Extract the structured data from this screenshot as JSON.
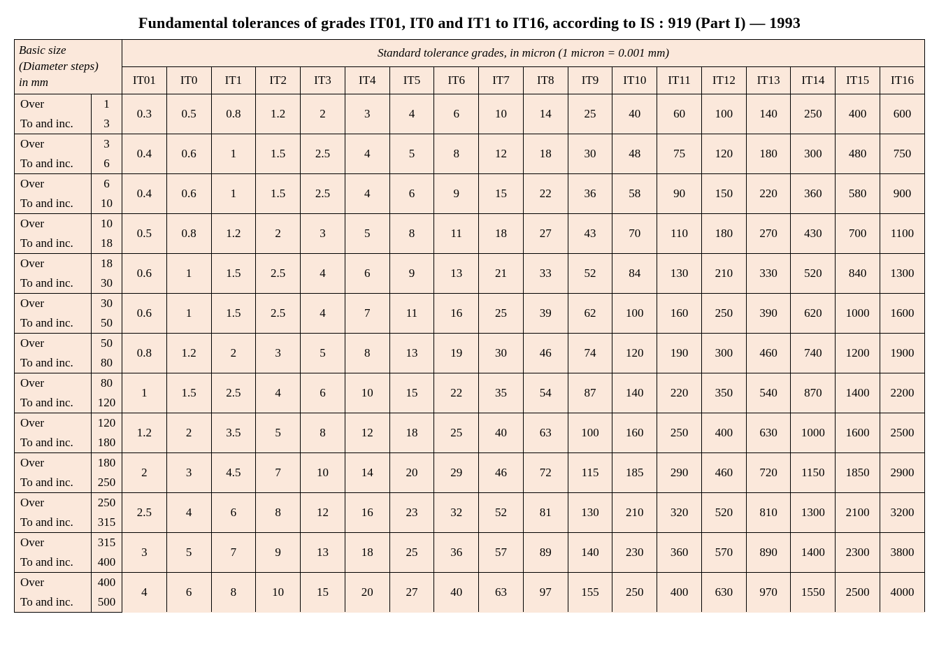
{
  "title": "Fundamental tolerances of grades IT01, IT0 and IT1 to IT16, according to IS : 919 (Part I) — 1993",
  "header": {
    "basic_size_line1": "Basic size",
    "basic_size_line2": "(Diameter steps)",
    "basic_size_line3": "in mm",
    "span_label": "Standard tolerance grades, in micron (1 micron = 0.001 mm)",
    "over_label": "Over",
    "to_inc_label": "To and inc."
  },
  "chart_data": {
    "type": "table",
    "grades": [
      "IT01",
      "IT0",
      "IT1",
      "IT2",
      "IT3",
      "IT4",
      "IT5",
      "IT6",
      "IT7",
      "IT8",
      "IT9",
      "IT10",
      "IT11",
      "IT12",
      "IT13",
      "IT14",
      "IT15",
      "IT16"
    ],
    "size_ranges": [
      {
        "over": "1",
        "to": "3"
      },
      {
        "over": "3",
        "to": "6"
      },
      {
        "over": "6",
        "to": "10"
      },
      {
        "over": "10",
        "to": "18"
      },
      {
        "over": "18",
        "to": "30"
      },
      {
        "over": "30",
        "to": "50"
      },
      {
        "over": "50",
        "to": "80"
      },
      {
        "over": "80",
        "to": "120"
      },
      {
        "over": "120",
        "to": "180"
      },
      {
        "over": "180",
        "to": "250"
      },
      {
        "over": "250",
        "to": "315"
      },
      {
        "over": "315",
        "to": "400"
      },
      {
        "over": "400",
        "to": "500"
      }
    ],
    "values": [
      [
        "0.3",
        "0.5",
        "0.8",
        "1.2",
        "2",
        "3",
        "4",
        "6",
        "10",
        "14",
        "25",
        "40",
        "60",
        "100",
        "140",
        "250",
        "400",
        "600"
      ],
      [
        "0.4",
        "0.6",
        "1",
        "1.5",
        "2.5",
        "4",
        "5",
        "8",
        "12",
        "18",
        "30",
        "48",
        "75",
        "120",
        "180",
        "300",
        "480",
        "750"
      ],
      [
        "0.4",
        "0.6",
        "1",
        "1.5",
        "2.5",
        "4",
        "6",
        "9",
        "15",
        "22",
        "36",
        "58",
        "90",
        "150",
        "220",
        "360",
        "580",
        "900"
      ],
      [
        "0.5",
        "0.8",
        "1.2",
        "2",
        "3",
        "5",
        "8",
        "11",
        "18",
        "27",
        "43",
        "70",
        "110",
        "180",
        "270",
        "430",
        "700",
        "1100"
      ],
      [
        "0.6",
        "1",
        "1.5",
        "2.5",
        "4",
        "6",
        "9",
        "13",
        "21",
        "33",
        "52",
        "84",
        "130",
        "210",
        "330",
        "520",
        "840",
        "1300"
      ],
      [
        "0.6",
        "1",
        "1.5",
        "2.5",
        "4",
        "7",
        "11",
        "16",
        "25",
        "39",
        "62",
        "100",
        "160",
        "250",
        "390",
        "620",
        "1000",
        "1600"
      ],
      [
        "0.8",
        "1.2",
        "2",
        "3",
        "5",
        "8",
        "13",
        "19",
        "30",
        "46",
        "74",
        "120",
        "190",
        "300",
        "460",
        "740",
        "1200",
        "1900"
      ],
      [
        "1",
        "1.5",
        "2.5",
        "4",
        "6",
        "10",
        "15",
        "22",
        "35",
        "54",
        "87",
        "140",
        "220",
        "350",
        "540",
        "870",
        "1400",
        "2200"
      ],
      [
        "1.2",
        "2",
        "3.5",
        "5",
        "8",
        "12",
        "18",
        "25",
        "40",
        "63",
        "100",
        "160",
        "250",
        "400",
        "630",
        "1000",
        "1600",
        "2500"
      ],
      [
        "2",
        "3",
        "4.5",
        "7",
        "10",
        "14",
        "20",
        "29",
        "46",
        "72",
        "115",
        "185",
        "290",
        "460",
        "720",
        "1150",
        "1850",
        "2900"
      ],
      [
        "2.5",
        "4",
        "6",
        "8",
        "12",
        "16",
        "23",
        "32",
        "52",
        "81",
        "130",
        "210",
        "320",
        "520",
        "810",
        "1300",
        "2100",
        "3200"
      ],
      [
        "3",
        "5",
        "7",
        "9",
        "13",
        "18",
        "25",
        "36",
        "57",
        "89",
        "140",
        "230",
        "360",
        "570",
        "890",
        "1400",
        "2300",
        "3800"
      ],
      [
        "4",
        "6",
        "8",
        "10",
        "15",
        "20",
        "27",
        "40",
        "63",
        "97",
        "155",
        "250",
        "400",
        "630",
        "970",
        "1550",
        "2500",
        "4000"
      ]
    ]
  }
}
